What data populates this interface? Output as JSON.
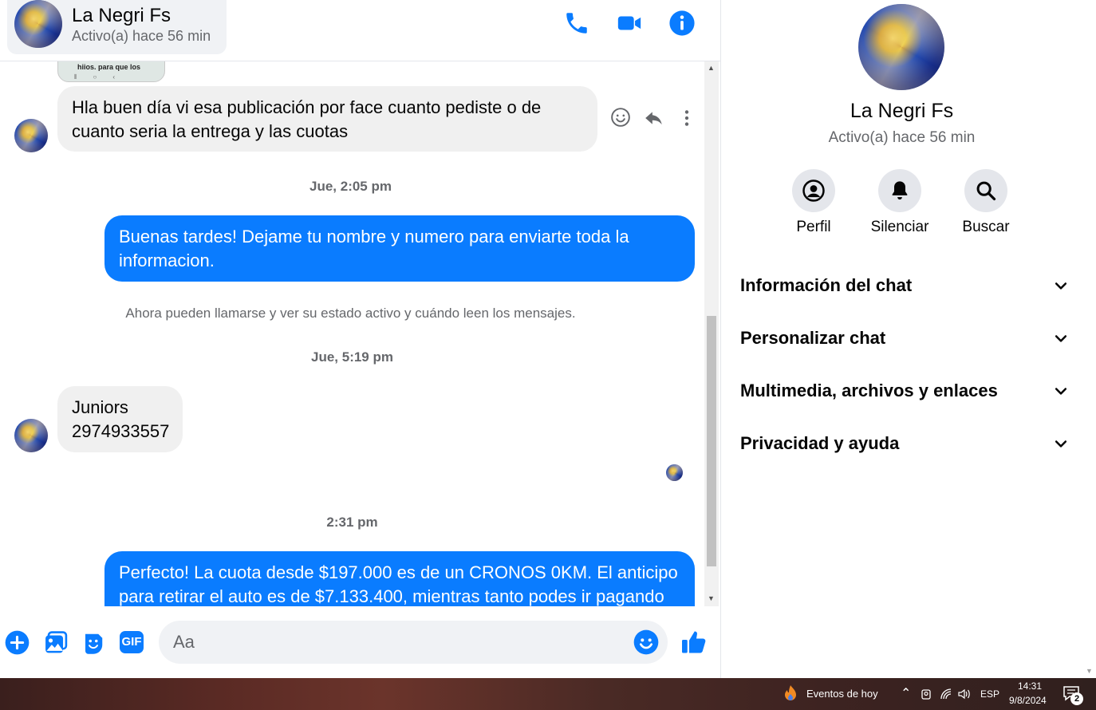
{
  "header": {
    "name": "La Negri Fs",
    "status": "Activo(a) hace 56 min",
    "icons": [
      "phone-icon",
      "video-icon",
      "info-icon"
    ],
    "accent": "#0a7cff"
  },
  "chat": {
    "preview_caption": "hiios. para que los",
    "messages": [
      {
        "dir": "in",
        "text_line1": "Hla buen día vi esa publicación por face cuanto pediste  o de",
        "text_line2": "cuanto seria la entrega y las cuotas"
      },
      {
        "dir": "out",
        "text_line1": "Buenas tardes! Dejame tu nombre y  numero para enviarte toda la",
        "text_line2": "informacion."
      },
      {
        "dir": "in",
        "text_line1": "Juniors",
        "text_line2": "2974933557"
      },
      {
        "dir": "out",
        "text_line1": "Perfecto! La cuota desde $197.000 es de un CRONOS 0KM. El anticipo",
        "text_line2": "para retirar el auto es de $7.133.400, mientras tanto podes ir pagando"
      }
    ],
    "timestamps": [
      "Jue, 2:05 pm",
      "Jue, 5:19 pm",
      "2:31 pm"
    ],
    "system_message": "Ahora pueden llamarse y ver su estado activo y cuándo leen los mensajes."
  },
  "composer": {
    "placeholder": "Aa",
    "icons": [
      "plus-icon",
      "image-icon",
      "sticker-icon",
      "gif-icon",
      "emoji-icon",
      "like-icon"
    ],
    "gif_label": "GIF"
  },
  "right_panel": {
    "name": "La Negri Fs",
    "status": "Activo(a) hace 56 min",
    "actions": [
      {
        "label": "Perfil",
        "icon": "profile-icon"
      },
      {
        "label": "Silenciar",
        "icon": "bell-icon"
      },
      {
        "label": "Buscar",
        "icon": "search-icon"
      }
    ],
    "sections": [
      "Información del chat",
      "Personalizar chat",
      "Multimedia, archivos y enlaces",
      "Privacidad y ayuda"
    ]
  },
  "taskbar": {
    "events": "Eventos de hoy",
    "language": "ESP",
    "time": "14:31",
    "date": "9/8/2024",
    "notifications": "2"
  }
}
